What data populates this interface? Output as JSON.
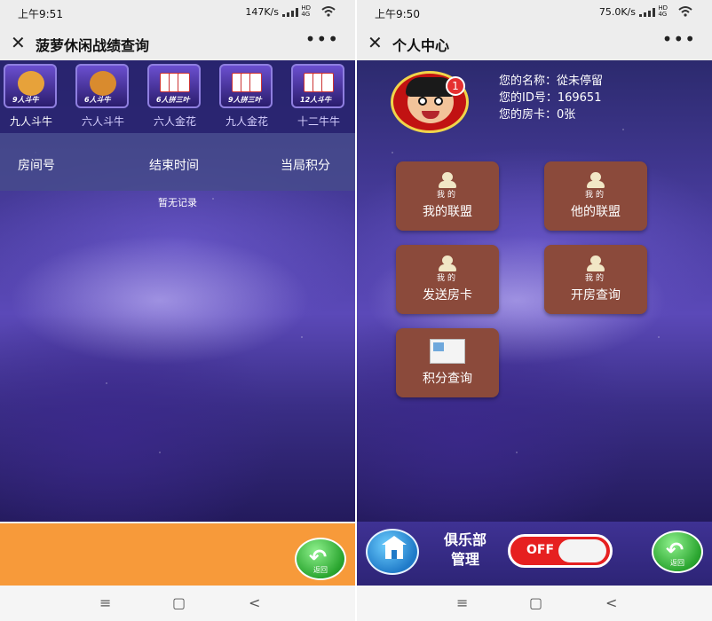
{
  "left": {
    "status": {
      "time": "上午9:51",
      "net": "147K/s"
    },
    "title": "菠萝休闲战绩查询",
    "game_tabs": [
      {
        "label": "九人斗牛",
        "badge": "9人斗牛"
      },
      {
        "label": "六人斗牛",
        "badge": "6人斗牛"
      },
      {
        "label": "六人金花",
        "badge": "6人拼三叶"
      },
      {
        "label": "九人金花",
        "badge": "9人拼三叶"
      },
      {
        "label": "十二牛牛",
        "badge": "12人斗牛"
      }
    ],
    "table_headers": [
      "房间号",
      "结束时间",
      "当局积分"
    ],
    "empty_text": "暂无记录",
    "back_label": "返回"
  },
  "right": {
    "status": {
      "time": "上午9:50",
      "net": "75.0K/s"
    },
    "title": "个人中心",
    "notification_count": "1",
    "profile": {
      "name_line": "您的名称：從未停留",
      "id_line": "您的ID号：169651",
      "card_line": "您的房卡：0张"
    },
    "menu": [
      {
        "label": "我的联盟",
        "mini": "我的"
      },
      {
        "label": "他的联盟",
        "mini": "我的"
      },
      {
        "label": "发送房卡",
        "mini": "我的"
      },
      {
        "label": "开房查询",
        "mini": "我的"
      },
      {
        "label": "积分查询",
        "mini": ""
      }
    ],
    "club_label_line1": "俱乐部",
    "club_label_line2": "管理",
    "toggle_label": "OFF",
    "back_label": "返回"
  },
  "nav": {
    "menu_icon": "≡",
    "home_icon": "▢",
    "back_icon": "<"
  },
  "colors": {
    "orange_bar": "#f79a3a",
    "menu_button": "#8b4a3b",
    "toggle_red": "#e62020"
  }
}
